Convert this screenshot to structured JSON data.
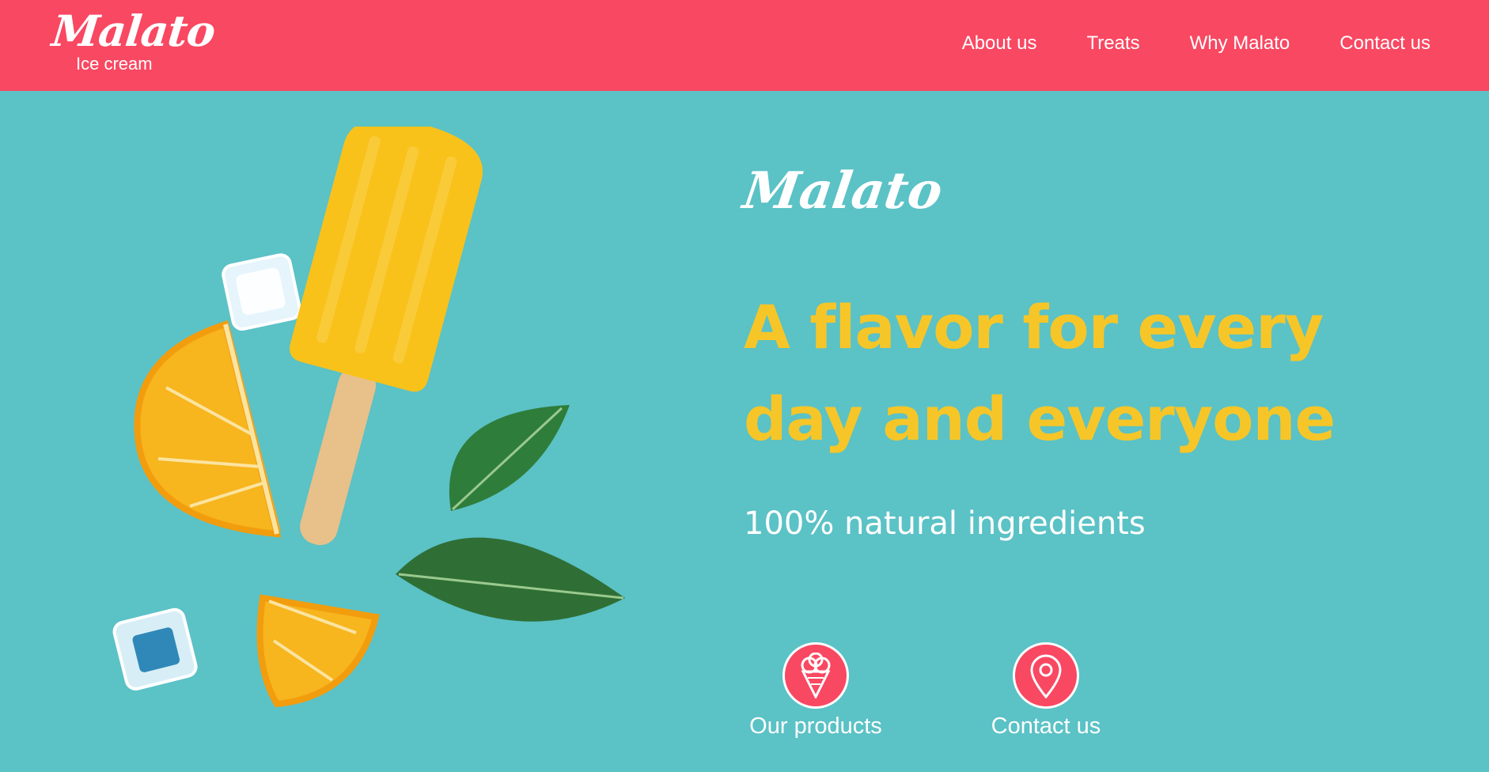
{
  "header": {
    "logo_script": "Malato",
    "logo_sub": "Ice cream",
    "nav": [
      {
        "label": "About us"
      },
      {
        "label": "Treats"
      },
      {
        "label": "Why Malato"
      },
      {
        "label": "Contact us"
      }
    ]
  },
  "hero": {
    "brand": "Malato",
    "headline": "A flavor for every day and everyone",
    "subtitle": "100% natural ingredients"
  },
  "actions": [
    {
      "label": "Our products",
      "icon": "ice-cream-cone-icon"
    },
    {
      "label": "Contact us",
      "icon": "location-pin-icon"
    }
  ],
  "colors": {
    "nav_background": "#f94862",
    "hero_background": "#5bc2c6",
    "headline": "#f6c628",
    "text": "#ffffff"
  }
}
